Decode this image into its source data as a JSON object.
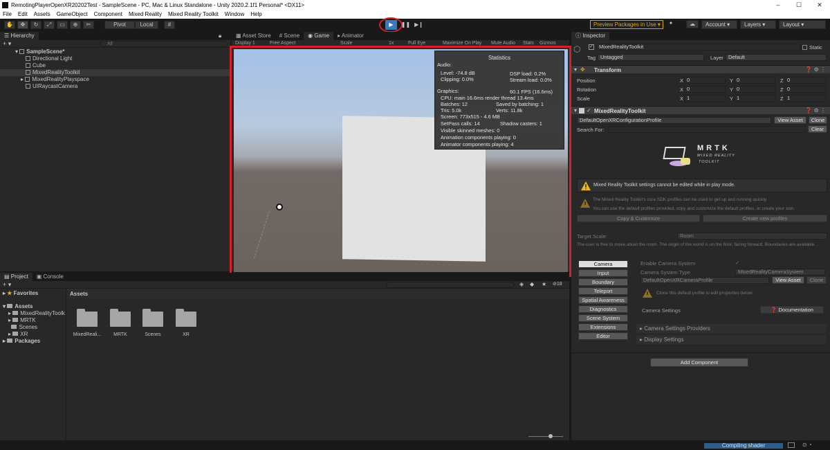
{
  "window": {
    "title": "RemotingPlayerOpenXR20202Test - SampleScene - PC, Mac & Linux Standalone - Unity 2020.2.1f1 Personal* <DX11>",
    "controls": [
      "–",
      "☐",
      "✕"
    ]
  },
  "menu": [
    "File",
    "Edit",
    "Assets",
    "GameObject",
    "Component",
    "Mixed Reality",
    "Mixed Reality Toolkit",
    "Window",
    "Help"
  ],
  "toolbar": {
    "pivot": "Pivot",
    "local": "Local",
    "play_icon": "▶",
    "pause_icon": "❚❚",
    "step_icon": "▶❙",
    "preview_packages": "Preview Packages in Use ▾",
    "account": "Account",
    "layers": "Layers",
    "layout": "Layout",
    "accent_color": "#3a79bb",
    "highlight_color": "#d51f2a"
  },
  "hierarchy": {
    "tab": "Hierarchy",
    "search_placeholder": "All",
    "scene": "SampleScene*",
    "items": [
      "Directional Light",
      "Cube",
      "MixedRealityToolkit",
      "MixedRealityPlayspace",
      "UIRaycastCamera"
    ]
  },
  "center_tabs": [
    "Asset Store",
    "Scene",
    "Game",
    "Animator"
  ],
  "game_toolbar": [
    "Display 1",
    "Free Aspect",
    "Scale",
    "1x",
    "Full Eye",
    "Maximize On Play",
    "Mute Audio",
    "Stats",
    "Gizmos"
  ],
  "stats": {
    "title": "Statistics",
    "audio_header": "Audio:",
    "level": "Level: -74.8 dB",
    "clipping": "Clipping: 0.0%",
    "dsp": "DSP load: 0.2%",
    "stream": "Stream load: 0.0%",
    "graphics_header": "Graphics:",
    "fps": "60.1 FPS (16.6ms)",
    "cpu": "CPU: main 16.6ms  render thread 13.4ms",
    "batches": "Batches: 12",
    "saved": "Saved by batching: 1",
    "tris": "Tris: 5.0k",
    "verts": "Verts: 11.8k",
    "screen": "Screen: 773x515 - 4.6 MB",
    "setpass": "SetPass calls: 14",
    "shadow": "Shadow casters: 1",
    "skinned": "Visible skinned meshes: 0",
    "anim": "Animation components playing: 0",
    "animator": "Animator components playing: 4"
  },
  "project": {
    "tabs": [
      "Project",
      "Console"
    ],
    "favorites": "Favorites",
    "assets_root": "Assets",
    "tree": [
      "MixedRealityToolk",
      "MRTK",
      "Scenes",
      "XR"
    ],
    "packages": "Packages",
    "breadcrumb": "Assets",
    "folders": [
      "MixedReali...",
      "MRTK",
      "Scenes",
      "XR"
    ],
    "hidden_count": "18"
  },
  "inspector": {
    "tab": "Inspector",
    "object_name": "MixedRealityToolkit",
    "static": "Static",
    "tag_label": "Tag",
    "tag_value": "Untagged",
    "layer_label": "Layer",
    "layer_value": "Default",
    "transform": "Transform",
    "position": "Position",
    "rotation": "Rotation",
    "scale": "Scale",
    "pos": [
      "0",
      "0",
      "0"
    ],
    "rot": [
      "0",
      "0",
      "0"
    ],
    "scl": [
      "1",
      "1",
      "1"
    ],
    "axes": [
      "X",
      "Y",
      "Z"
    ],
    "component": "MixedRealityToolkit",
    "profile": "DefaultOpenXRConfigurationProfile",
    "view_asset": "View Asset",
    "clone": "Clone",
    "search_for": "Search For:",
    "clear": "Clear",
    "logo_title": "MRTK",
    "logo_sub1": "MIXED REALITY",
    "logo_sub2": "TOOLKIT",
    "warning1": "Mixed Reality Toolkit settings cannot be edited while in play mode.",
    "warning2a": "The Mixed Reality Toolkit's core SDK profiles can be used to get up and running quickly.",
    "warning2b": "You can use the default profiles provided, copy and customize the default profiles, or create your own.",
    "copy_customize": "Copy & Customize",
    "create_profiles": "Create new profiles",
    "target_scale_label": "Target Scale:",
    "target_scale_value": "Room",
    "scale_desc": "The user is free to move about the room. The origin of the world is on the floor, facing forward. Boundaries are available.",
    "side_buttons": [
      "Camera",
      "Input",
      "Boundary",
      "Teleport",
      "Spatial Awareness",
      "Diagnostics",
      "Scene System",
      "Extensions",
      "Editor"
    ],
    "enable_camera": "Enable Camera System",
    "camera_type_label": "Camera System Type",
    "camera_type_value": "MixedRealityCameraSystem",
    "camera_profile": "DefaultOpenXRCameraProfile",
    "clone_hint": "Clone this default profile to edit properties below",
    "camera_settings": "Camera Settings",
    "documentation": "Documentation",
    "providers": "Camera Settings Providers",
    "display_settings": "Display Settings",
    "add_component": "Add Component"
  },
  "status": {
    "compiling": "Compiling shader"
  }
}
